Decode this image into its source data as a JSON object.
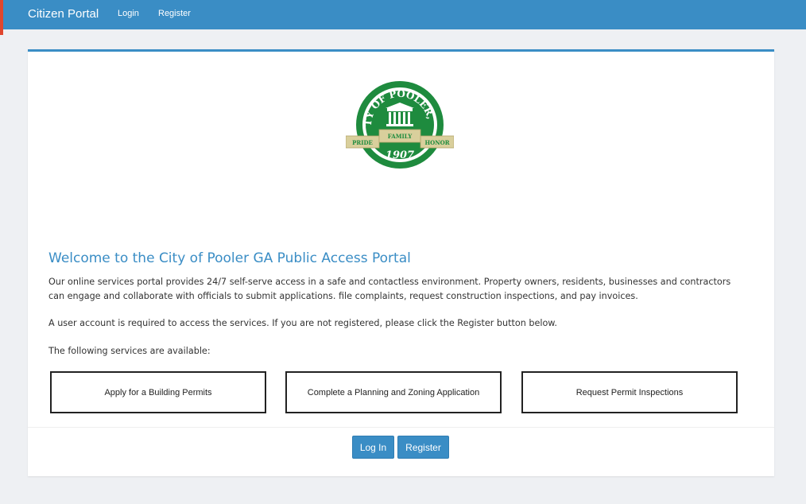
{
  "nav": {
    "brand": "Citizen Portal",
    "login": "Login",
    "register": "Register"
  },
  "seal": {
    "top_text": "CITY OF POOLER, GA",
    "left_banner": "PRIDE",
    "center_banner": "FAMILY",
    "right_banner": "HONOR",
    "year": "1907"
  },
  "content": {
    "title": "Welcome to the City of Pooler GA Public Access Portal",
    "intro_line1": "Our online services portal provides 24/7 self-serve access in a safe and contactless environment. Property owners, residents, businesses and contractors",
    "intro_line2": "can engage and collaborate with officials to submit applications. file complaints, request construction inspections, and pay invoices.",
    "account_note": "A user account is required to access the services. If you are not registered, please click the Register button below.",
    "services_intro": "The following services are available:"
  },
  "services": [
    "Apply for a Building Permits",
    "Complete a Planning and Zoning Application",
    "Request Permit Inspections"
  ],
  "actions": {
    "login": "Log In",
    "register": "Register"
  },
  "colors": {
    "navbar": "#3a8dc5",
    "accent_marker": "#e0462d",
    "seal_green": "#1e8b3e",
    "seal_banner": "#d9cf9c"
  }
}
